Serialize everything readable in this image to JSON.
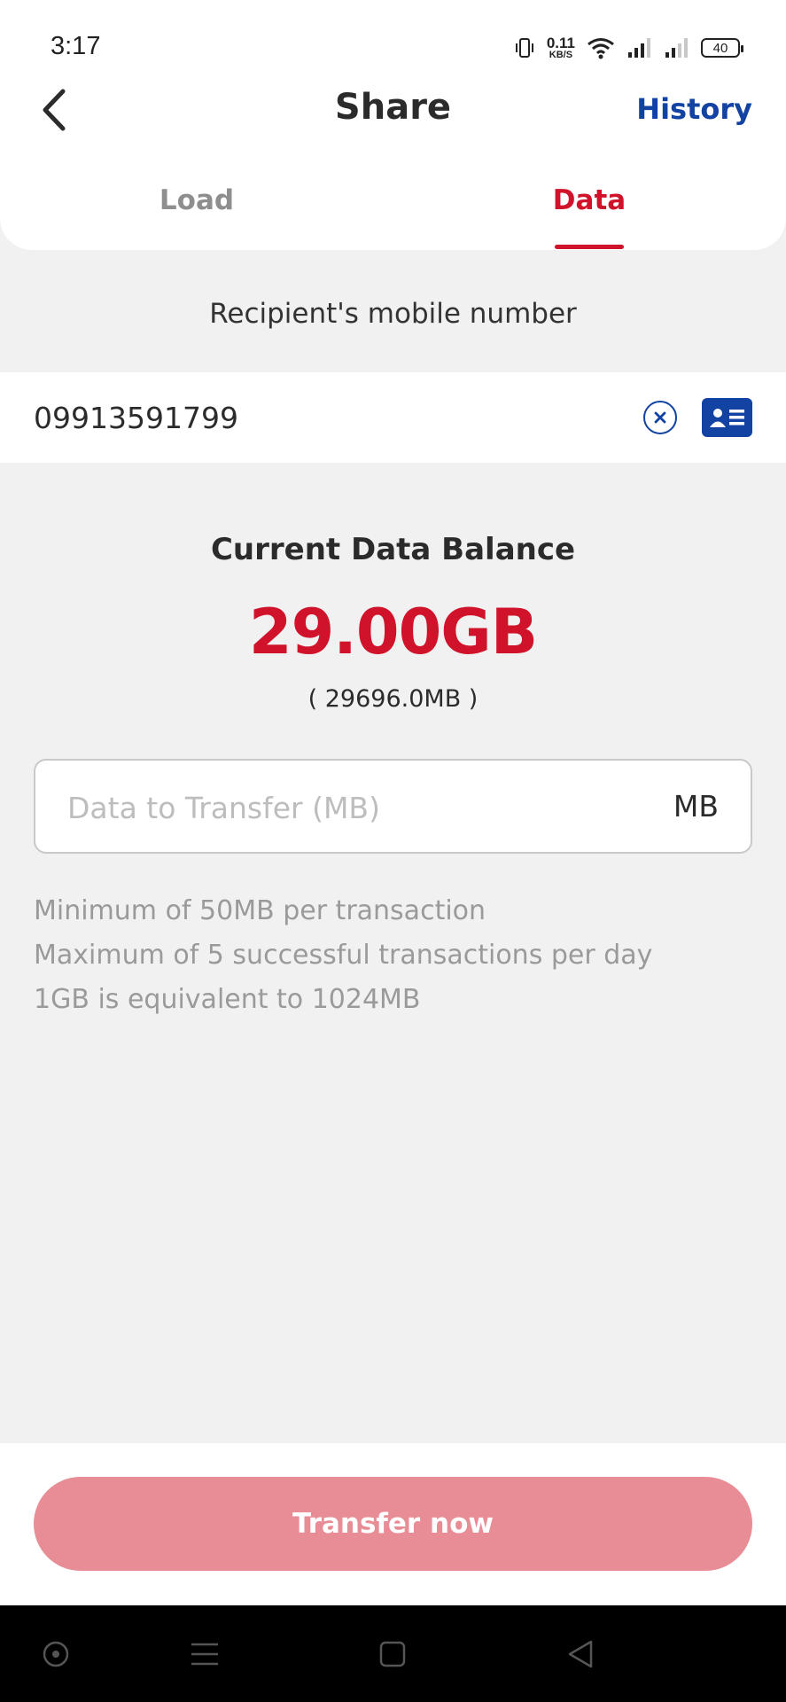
{
  "status_bar": {
    "time": "3:17",
    "net_speed_value": "0.11",
    "net_speed_unit": "KB/S",
    "battery": "40",
    "icons": [
      "vibrate-icon",
      "wifi-icon",
      "signal-icon",
      "signal-icon-2",
      "battery-icon"
    ]
  },
  "header": {
    "title": "Share",
    "history_label": "History",
    "tabs": [
      {
        "label": "Load",
        "active": false
      },
      {
        "label": "Data",
        "active": true
      }
    ]
  },
  "recipient": {
    "label": "Recipient's mobile number",
    "number": "09913591799"
  },
  "balance": {
    "label": "Current Data Balance",
    "value": "29.00GB",
    "mb_value": "( 29696.0MB )"
  },
  "transfer_field": {
    "placeholder": "Data to Transfer (MB)",
    "unit": "MB"
  },
  "notes": [
    "Minimum of 50MB per transaction",
    "Maximum of 5 successful transactions per day",
    "1GB is equivalent to 1024MB"
  ],
  "actions": {
    "transfer_label": "Transfer now"
  },
  "colors": {
    "accent_red": "#d0132b",
    "accent_blue": "#1243a3",
    "button_disabled": "#e88d96"
  }
}
